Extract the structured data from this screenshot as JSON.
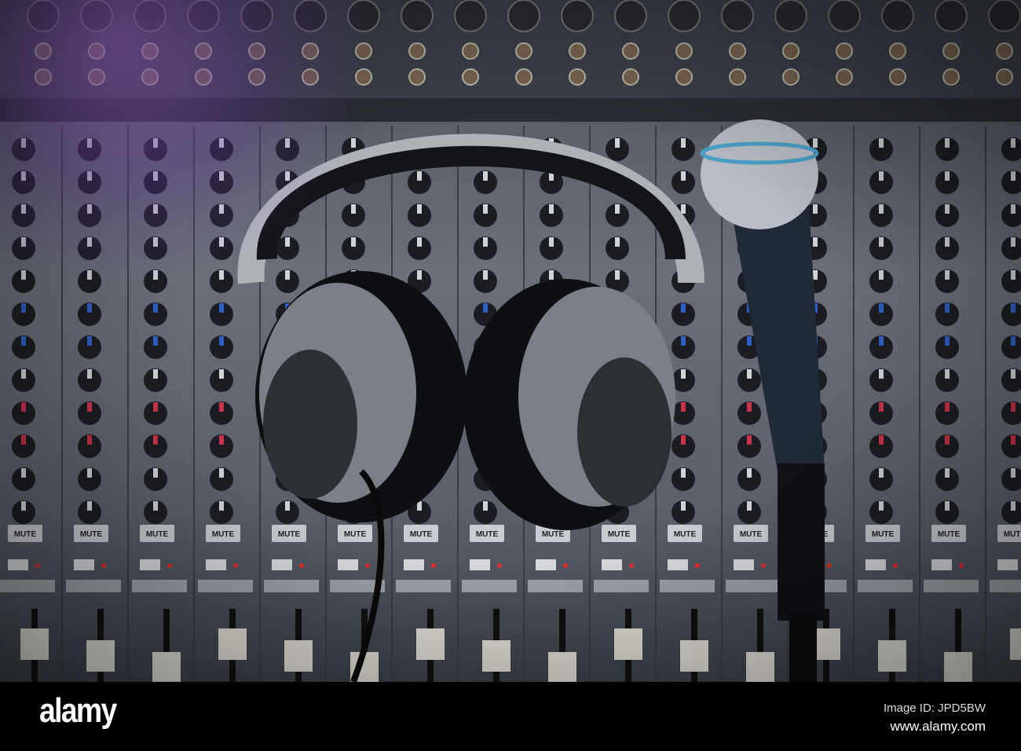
{
  "photo": {
    "subject": "headphones and microphone on audio mixer"
  },
  "palette": {
    "knob": "#1b1d22",
    "blue_cap": "#2d5fc4",
    "red_cap": "#c8324a",
    "panel": "#5e636b",
    "tint": "#b07aff",
    "mic_grille": "#b9bec4",
    "mic_ring": "#4aa0c8"
  },
  "mixer_labels": {
    "mute": "MUTE"
  },
  "footer": {
    "logo": "alamy",
    "image_id": "Image ID: JPD5BW",
    "website": "www.alamy.com"
  }
}
